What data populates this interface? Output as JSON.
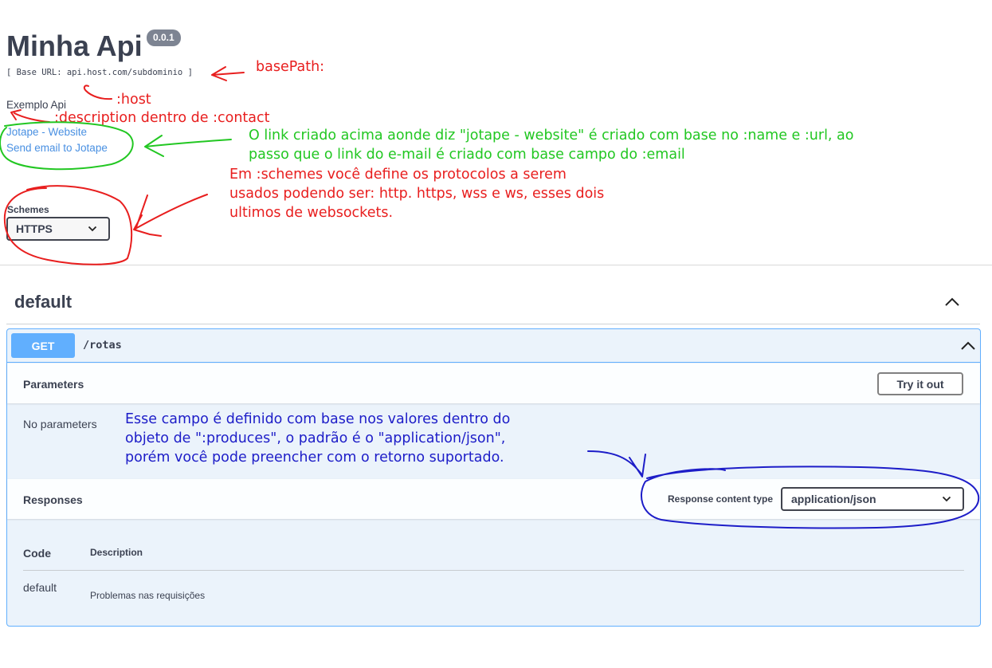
{
  "info": {
    "title": "Minha Api",
    "version": "0.0.1",
    "base_url": "[ Base URL: api.host.com/subdominio ]",
    "description": "Exemplo Api",
    "contact_website": "Jotape - Website",
    "contact_email": "Send email to Jotape"
  },
  "schemes": {
    "label": "Schemes",
    "selected": "HTTPS"
  },
  "tag": {
    "name": "default"
  },
  "operation": {
    "method": "GET",
    "path": "/rotas",
    "parameters_title": "Parameters",
    "try_it_out": "Try it out",
    "no_parameters": "No parameters",
    "responses_title": "Responses",
    "response_content_type_label": "Response content type",
    "response_content_type": "application/json",
    "col_code": "Code",
    "col_description": "Description",
    "responses": [
      {
        "code": "default",
        "description": "Problemas nas requisições"
      }
    ]
  },
  "annotations": {
    "basepath": "basePath:",
    "host": ":host",
    "contact": ":description dentro de :contact",
    "link_note": [
      "O link criado acima aonde diz \"jotape - website\" é criado com base no :name e :url, ao",
      "passo que o link do e-mail é criado com base campo do :email"
    ],
    "schemes_note": [
      "Em :schemes você define os protocolos a serem",
      "usados podendo ser: http. https, wss e ws, esses dois",
      "ultimos de websockets."
    ],
    "produces_note": [
      "Esse campo é definido com base nos valores dentro do",
      "objeto de \":produces\", o padrão é o \"application/json\",",
      "porém você pode preencher com o retorno suportado."
    ],
    "colors": {
      "red": "#e81e1e",
      "green": "#22c722",
      "blue": "#1d1dc8"
    }
  },
  "colors": {
    "get_accent": "#61affe",
    "block_bg": "#ebf3fb",
    "text": "#3b4151",
    "link": "#4990e2"
  }
}
